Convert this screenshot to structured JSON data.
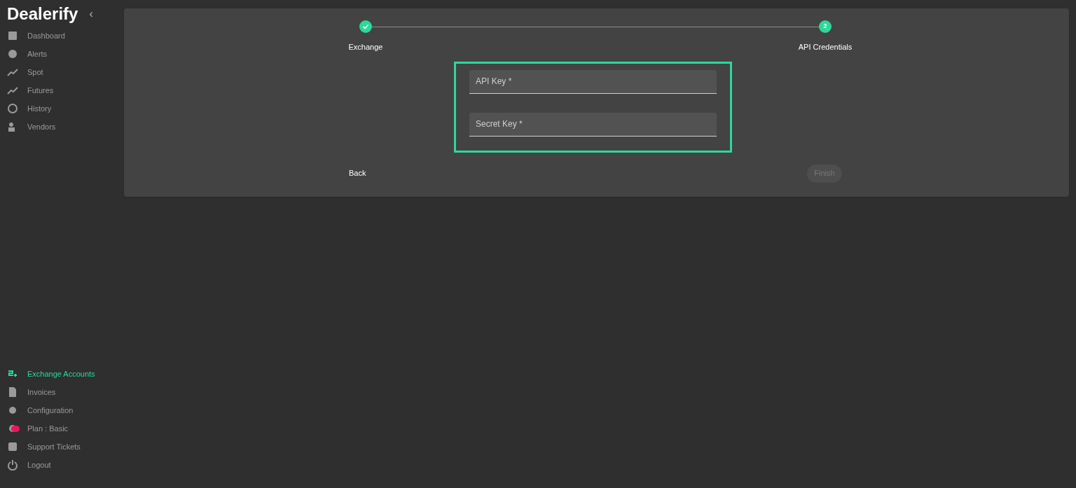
{
  "sidebar": {
    "logo": "Dealerify",
    "collapse": "‹",
    "top_items": [
      {
        "label": "Dashboard",
        "selected": false
      },
      {
        "label": "Alerts",
        "selected": false
      },
      {
        "label": "Spot",
        "selected": false
      },
      {
        "label": "Futures",
        "selected": false
      },
      {
        "label": "History",
        "selected": false
      },
      {
        "label": "Vendors",
        "selected": false
      }
    ],
    "bottom_items": [
      {
        "label": "Exchange Accounts",
        "selected": true
      },
      {
        "label": "Invoices",
        "selected": false
      },
      {
        "label": "Configuration",
        "selected": false
      },
      {
        "label": "Plan : Basic",
        "selected": false,
        "color": "#e8175d"
      },
      {
        "label": "Support Tickets",
        "selected": false
      },
      {
        "label": "Logout",
        "selected": false
      }
    ]
  },
  "stepper": [
    {
      "label": "Exchange",
      "completed": true
    },
    {
      "label": "API Credentials",
      "number": "2",
      "completed": false
    }
  ],
  "fields": [
    {
      "placeholder": "API Key *"
    },
    {
      "placeholder": "Secret Key *"
    }
  ],
  "back_button": "Back",
  "finish_button": {
    "label": "Finish",
    "disabled": true
  }
}
